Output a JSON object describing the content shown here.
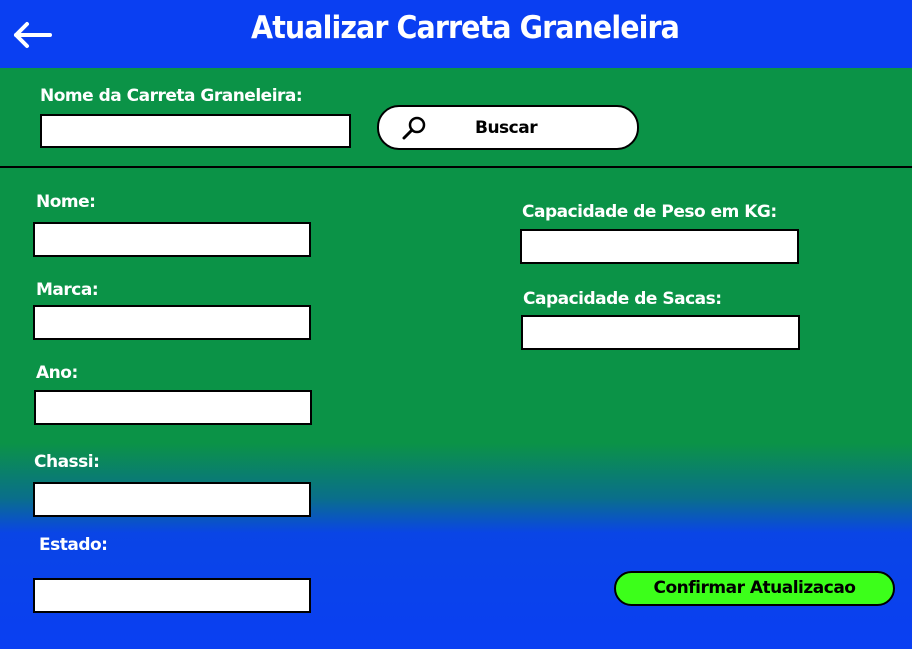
{
  "header": {
    "title": "Atualizar Carreta Graneleira",
    "back_icon": "arrow-left-icon",
    "background": "#0a3ff2"
  },
  "search": {
    "label": "Nome da Carreta Graneleira:",
    "value": "",
    "button_label": "Buscar",
    "button_icon": "search-icon",
    "background": "#0b9347"
  },
  "form": {
    "nome": {
      "label": "Nome:",
      "value": ""
    },
    "marca": {
      "label": "Marca:",
      "value": ""
    },
    "ano": {
      "label": "Ano:",
      "value": ""
    },
    "chassi": {
      "label": "Chassi:",
      "value": ""
    },
    "estado": {
      "label": "Estado:",
      "value": ""
    },
    "capacidade_peso": {
      "label": "Capacidade de Peso em KG:",
      "value": ""
    },
    "capacidade_sacas": {
      "label": "Capacidade de Sacas:",
      "value": ""
    }
  },
  "confirm": {
    "label": "Confirmar Atualizacao",
    "color": "#3cff1a"
  }
}
